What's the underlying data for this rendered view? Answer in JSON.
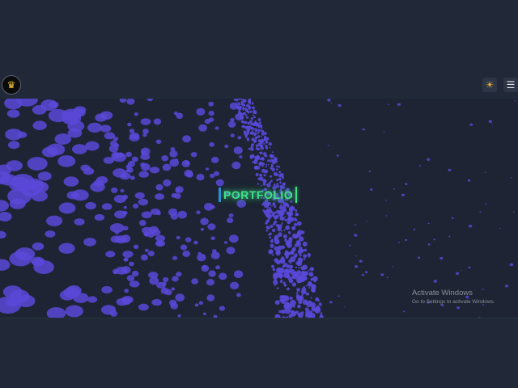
{
  "header": {
    "logo_icon": "crown-icon",
    "theme_toggle_icon": "sun-icon",
    "menu_icon": "hamburger-menu-icon"
  },
  "hero": {
    "title": "PORTFOLIO",
    "title_color": "#3fe08a",
    "particle_color": "#5a48d8",
    "background_color": "#1e2433"
  },
  "watermark": {
    "line1": "Activate Windows",
    "line2": "Go to Settings to activate Windows."
  },
  "colors": {
    "page_background": "#212938",
    "accent": "#e3b43a"
  }
}
